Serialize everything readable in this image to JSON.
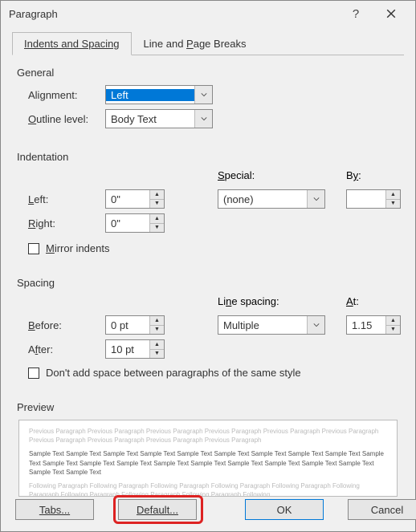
{
  "title": "Paragraph",
  "tabs": {
    "indents": "Indents and Spacing",
    "breaks": "Line and Page Breaks"
  },
  "general": {
    "label": "General",
    "alignment_label_pre": "Ali",
    "alignment_label_u": "g",
    "alignment_label_post": "nment:",
    "alignment_value": "Left",
    "outline_label_pre": "",
    "outline_label_u": "O",
    "outline_label_post": "utline level:",
    "outline_value": "Body Text"
  },
  "indentation": {
    "label": "Indentation",
    "left_u": "L",
    "left_post": "eft:",
    "left_value": "0\"",
    "right_u": "R",
    "right_post": "ight:",
    "right_value": "0\"",
    "special_u": "S",
    "special_post": "pecial:",
    "special_value": "(none)",
    "by_pre": "B",
    "by_u": "y",
    "by_post": ":",
    "by_value": "",
    "mirror_u": "M",
    "mirror_post": "irror indents"
  },
  "spacing": {
    "label": "Spacing",
    "before_u": "B",
    "before_post": "efore:",
    "before_value": "0 pt",
    "after_pre": "A",
    "after_u": "f",
    "after_post": "ter:",
    "after_value": "10 pt",
    "ls_pre": "Li",
    "ls_u": "n",
    "ls_post": "e spacing:",
    "ls_value": "Multiple",
    "at_u": "A",
    "at_post": "t:",
    "at_value": "1.15",
    "dontadd": "Don't add space between paragraphs of the same style"
  },
  "preview": {
    "label": "Preview",
    "prev_text": "Previous Paragraph Previous Paragraph Previous Paragraph Previous Paragraph Previous Paragraph Previous Paragraph Previous Paragraph Previous Paragraph Previous Paragraph Previous Paragraph",
    "sample_text": "Sample Text Sample Text Sample Text Sample Text Sample Text Sample Text Sample Text Sample Text Sample Text Sample Text Sample Text Sample Text Sample Text Sample Text Sample Text Sample Text Sample Text Sample Text Sample Text Sample Text Sample Text",
    "follow_text": "Following Paragraph Following Paragraph Following Paragraph Following Paragraph Following Paragraph Following Paragraph Following Paragraph Following Paragraph Following Paragraph Following"
  },
  "buttons": {
    "tabs": "Tabs...",
    "default": "Default...",
    "ok": "OK",
    "cancel": "Cancel"
  }
}
